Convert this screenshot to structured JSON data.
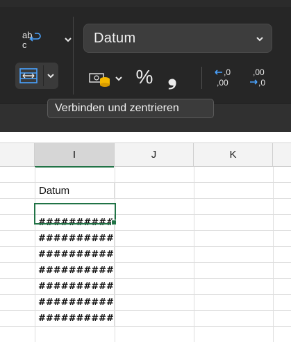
{
  "ribbon": {
    "wrap_text": {
      "icon": "wrap-text-icon",
      "label": "ab c"
    },
    "merge": {
      "icon": "merge-center-icon"
    },
    "number_format": {
      "value": "Datum"
    },
    "currency": {
      "icon": "accounting-format-icon"
    },
    "percent_label": "%",
    "comma_label": "❟",
    "increase_decimal": {
      "icon": "increase-decimal-icon",
      "top": ".0",
      "bottom": ",00"
    },
    "decrease_decimal": {
      "icon": "decrease-decimal-icon",
      "top": ",00",
      "bottom": ",0"
    }
  },
  "tooltip": {
    "text": "Verbinden und zentrieren"
  },
  "sheet": {
    "columns": [
      {
        "label": "I",
        "selected": true
      },
      {
        "label": "J",
        "selected": false
      },
      {
        "label": "K",
        "selected": false
      }
    ],
    "cells": {
      "header": "Datum",
      "values": [
        "##########",
        "##########",
        "##########",
        "##########",
        "##########",
        "##########",
        "##########"
      ]
    }
  },
  "colors": {
    "accent_green": "#217346",
    "ribbon_bg": "#262626",
    "tooltip_bg": "#3b3b3b"
  }
}
